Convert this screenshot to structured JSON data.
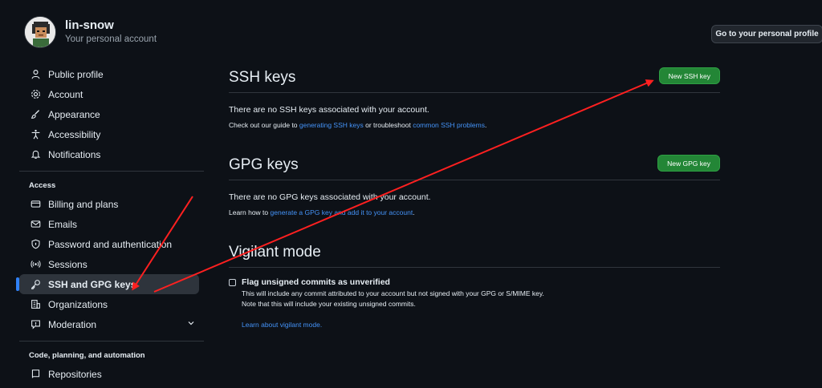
{
  "header": {
    "username": "lin-snow",
    "subtitle": "Your personal account",
    "go_profile_label": "Go to your personal profile"
  },
  "sidebar": {
    "items": [
      {
        "label": "Public profile",
        "icon": "person-icon"
      },
      {
        "label": "Account",
        "icon": "gear-icon"
      },
      {
        "label": "Appearance",
        "icon": "paintbrush-icon"
      },
      {
        "label": "Accessibility",
        "icon": "accessibility-icon"
      },
      {
        "label": "Notifications",
        "icon": "bell-icon"
      }
    ],
    "access_label": "Access",
    "access_items": [
      {
        "label": "Billing and plans",
        "icon": "credit-card-icon"
      },
      {
        "label": "Emails",
        "icon": "mail-icon"
      },
      {
        "label": "Password and authentication",
        "icon": "shield-lock-icon"
      },
      {
        "label": "Sessions",
        "icon": "broadcast-icon"
      },
      {
        "label": "SSH and GPG keys",
        "icon": "key-icon"
      },
      {
        "label": "Organizations",
        "icon": "organization-icon"
      },
      {
        "label": "Moderation",
        "icon": "report-icon"
      }
    ],
    "code_label": "Code, planning, and automation",
    "code_items": [
      {
        "label": "Repositories",
        "icon": "repo-icon"
      }
    ]
  },
  "ssh": {
    "title": "SSH keys",
    "button": "New SSH key",
    "empty": "There are no SSH keys associated with your account.",
    "guide_prefix": "Check out our guide to ",
    "guide_link": "generating SSH keys",
    "guide_middle": " or troubleshoot ",
    "guide_link2": "common SSH problems",
    "guide_suffix": "."
  },
  "gpg": {
    "title": "GPG keys",
    "button": "New GPG key",
    "empty": "There are no GPG keys associated with your account.",
    "learn_prefix": "Learn how to ",
    "learn_link": "generate a GPG key and add it to your account",
    "learn_suffix": "."
  },
  "vigilant": {
    "title": "Vigilant mode",
    "checkbox_label": "Flag unsigned commits as unverified",
    "desc1": "This will include any commit attributed to your account but not signed with your GPG or S/MIME key.",
    "desc2": "Note that this will include your existing unsigned commits.",
    "learn_link": "Learn about vigilant mode."
  },
  "colors": {
    "background": "#0d1117",
    "accent_green": "#238636",
    "link_blue": "#4493f8",
    "annotation_red": "#ff2020"
  }
}
